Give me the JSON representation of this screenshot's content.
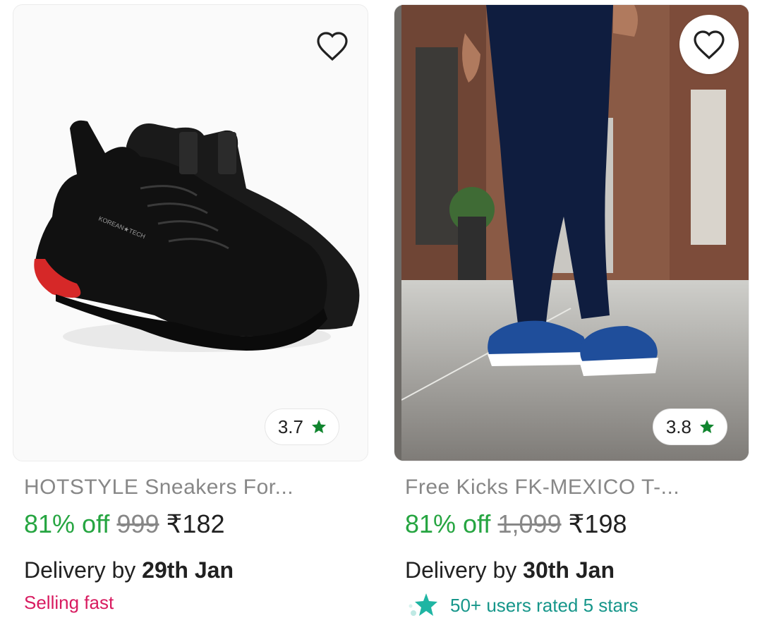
{
  "products": [
    {
      "name": "HOTSTYLE Sneakers For...",
      "rating": "3.7",
      "discount": "81% off",
      "mrp": "999",
      "price": "₹182",
      "delivery_prefix": "Delivery by",
      "delivery_date": "29th Jan",
      "note": "Selling fast",
      "icons": {
        "wishlist": "heart-outline-icon",
        "rating": "star-icon"
      },
      "colors": {
        "rating_star": "#11852f",
        "discount": "#26a541",
        "note": "#d81b60"
      }
    },
    {
      "name": "Free Kicks FK-MEXICO T-...",
      "rating": "3.8",
      "discount": "81% off",
      "mrp": "1,099",
      "price": "₹198",
      "delivery_prefix": "Delivery by",
      "delivery_date": "30th Jan",
      "note": "50+ users rated 5 stars",
      "icons": {
        "wishlist": "heart-outline-icon",
        "rating": "star-icon",
        "note": "sparkle-star-icon"
      },
      "colors": {
        "rating_star": "#11852f",
        "discount": "#26a541",
        "note": "#16968a"
      }
    }
  ]
}
